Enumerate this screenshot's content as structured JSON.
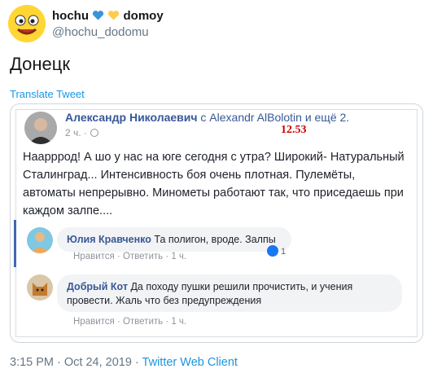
{
  "tweet": {
    "display_name": "hochu",
    "display_name_suffix": "domoy",
    "handle": "@hochu_dodomu",
    "text": "Донецк",
    "translate_label": "Translate Tweet",
    "timestamp": "3:15 PM · Oct 24, 2019 · ",
    "client": "Twitter Web Client",
    "heart_colors": [
      "#3b94d9",
      "#ffcc4d"
    ]
  },
  "fb": {
    "author": "Александр Николаевич",
    "with_text": "с Alexandr AlBolotin и ещё 2.",
    "time": "2 ч. ·",
    "stamp": "12.53",
    "post_text": "Наарррод! А шо у нас на юге сегодня с утра? Широкий- Натуральный Сталинград... Интенсивность боя очень плотная. Пулемёты, автоматы непрерывно. Минометы работают так, что приседаешь при каждом залпе....",
    "comments": [
      {
        "name": "Юлия Кравченко",
        "text": "Та полигон, вроде. Залпы",
        "actions": "Нравится · Ответить · 1 ч.",
        "likes": "1"
      },
      {
        "name": "Добрый Кот",
        "text": "Да походу пушки решили прочистить, и учения провести. Жаль что без предупреждения",
        "actions": "Нравится · Ответить · 1 ч."
      }
    ]
  }
}
